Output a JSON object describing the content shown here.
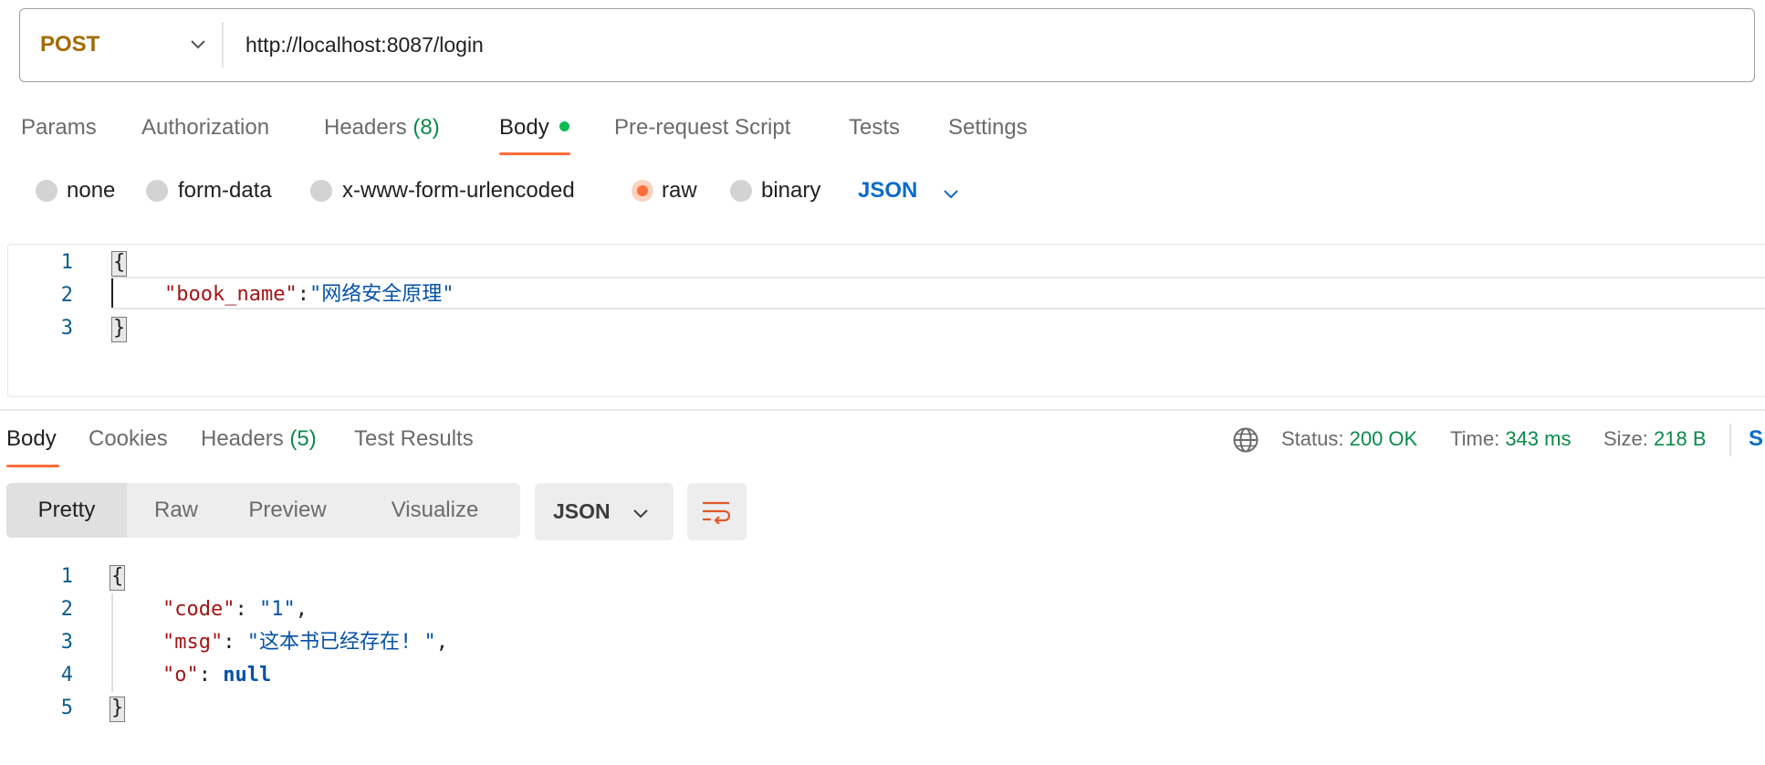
{
  "request": {
    "method": "POST",
    "url": "http://localhost:8087/login"
  },
  "request_tabs": [
    {
      "label": "Params"
    },
    {
      "label": "Authorization"
    },
    {
      "label": "Headers",
      "count": "(8)"
    },
    {
      "label": "Body",
      "active": true
    },
    {
      "label": "Pre-request Script"
    },
    {
      "label": "Tests"
    },
    {
      "label": "Settings"
    }
  ],
  "body_modes": [
    {
      "label": "none"
    },
    {
      "label": "form-data"
    },
    {
      "label": "x-www-form-urlencoded"
    },
    {
      "label": "raw",
      "selected": true
    },
    {
      "label": "binary"
    }
  ],
  "body_language": "JSON",
  "request_body": {
    "line_numbers": [
      "1",
      "2",
      "3"
    ],
    "open_brace": "{",
    "key": "\"book_name\"",
    "colon": ":",
    "value": "\"网络安全原理\"",
    "close_brace": "}"
  },
  "response_tabs": [
    {
      "label": "Body",
      "active": true
    },
    {
      "label": "Cookies"
    },
    {
      "label": "Headers",
      "count": "(5)"
    },
    {
      "label": "Test Results"
    }
  ],
  "response_meta": {
    "status_label": "Status:",
    "status_value": "200 OK",
    "time_label": "Time:",
    "time_value": "343 ms",
    "size_label": "Size:",
    "size_value": "218 B",
    "save_cut": "S"
  },
  "view_modes": [
    "Pretty",
    "Raw",
    "Preview",
    "Visualize"
  ],
  "response_format": "JSON",
  "response_body": {
    "line_numbers": [
      "1",
      "2",
      "3",
      "4",
      "5"
    ],
    "open_brace": "{",
    "code_key": "\"code\"",
    "code_value": "\"1\"",
    "msg_key": "\"msg\"",
    "msg_value": "\"这本书已经存在! \"",
    "o_key": "\"o\"",
    "o_value": "null",
    "close_brace": "}"
  },
  "colors": {
    "method": "#a26b00",
    "accent": "#ff6c37",
    "success": "#0a8a4a",
    "link": "#0b6bcb"
  },
  "icons": [
    "chevron-down-icon",
    "globe-icon",
    "wrap-lines-icon"
  ]
}
